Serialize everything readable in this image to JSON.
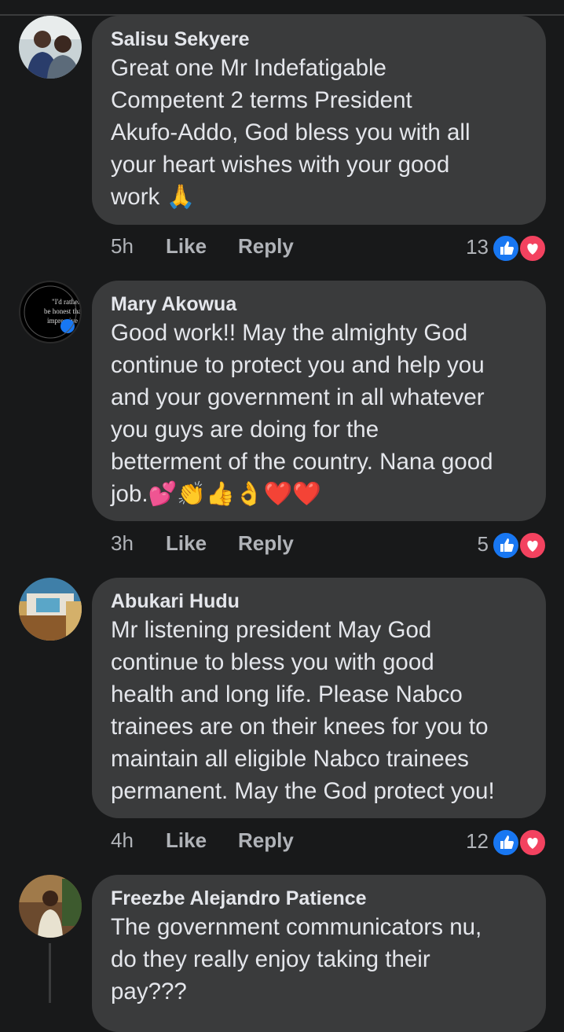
{
  "comments": [
    {
      "author": "Salisu Sekyere",
      "text": "Great one Mr Indefatigable\nCompetent 2 terms President\nAkufo-Addo, God bless you with all\nyour heart wishes with your good\nwork 🙏",
      "time": "5h",
      "like_label": "Like",
      "reply_label": "Reply",
      "reaction_count": "13"
    },
    {
      "author": "Mary Akowua",
      "text": "Good work!! May the almighty God\ncontinue to protect you and help you\nand your government in all whatever\nyou guys are doing for the\nbetterment of the country. Nana good\njob.💕👏👍👌❤️❤️",
      "time": "3h",
      "like_label": "Like",
      "reply_label": "Reply",
      "reaction_count": "5",
      "avatar_text": "I'd rather be honest than impressive"
    },
    {
      "author": "Abukari Hudu",
      "text": "Mr listening president May God\ncontinue to bless you with good\nhealth and long life. Please Nabco\ntrainees are on their knees for you to\nmaintain all eligible Nabco trainees\npermanent. May the God protect you!",
      "time": "4h",
      "like_label": "Like",
      "reply_label": "Reply",
      "reaction_count": "12"
    },
    {
      "author": "Freezbe Alejandro Patience",
      "text": "The government communicators nu,\ndo they really enjoy taking their\npay???"
    }
  ],
  "colors": {
    "background": "#18191a",
    "bubble": "#3a3b3c",
    "like_blue": "#1877f2",
    "love_red": "#f3425f"
  },
  "icons": [
    "like-reaction-icon",
    "love-reaction-icon"
  ]
}
